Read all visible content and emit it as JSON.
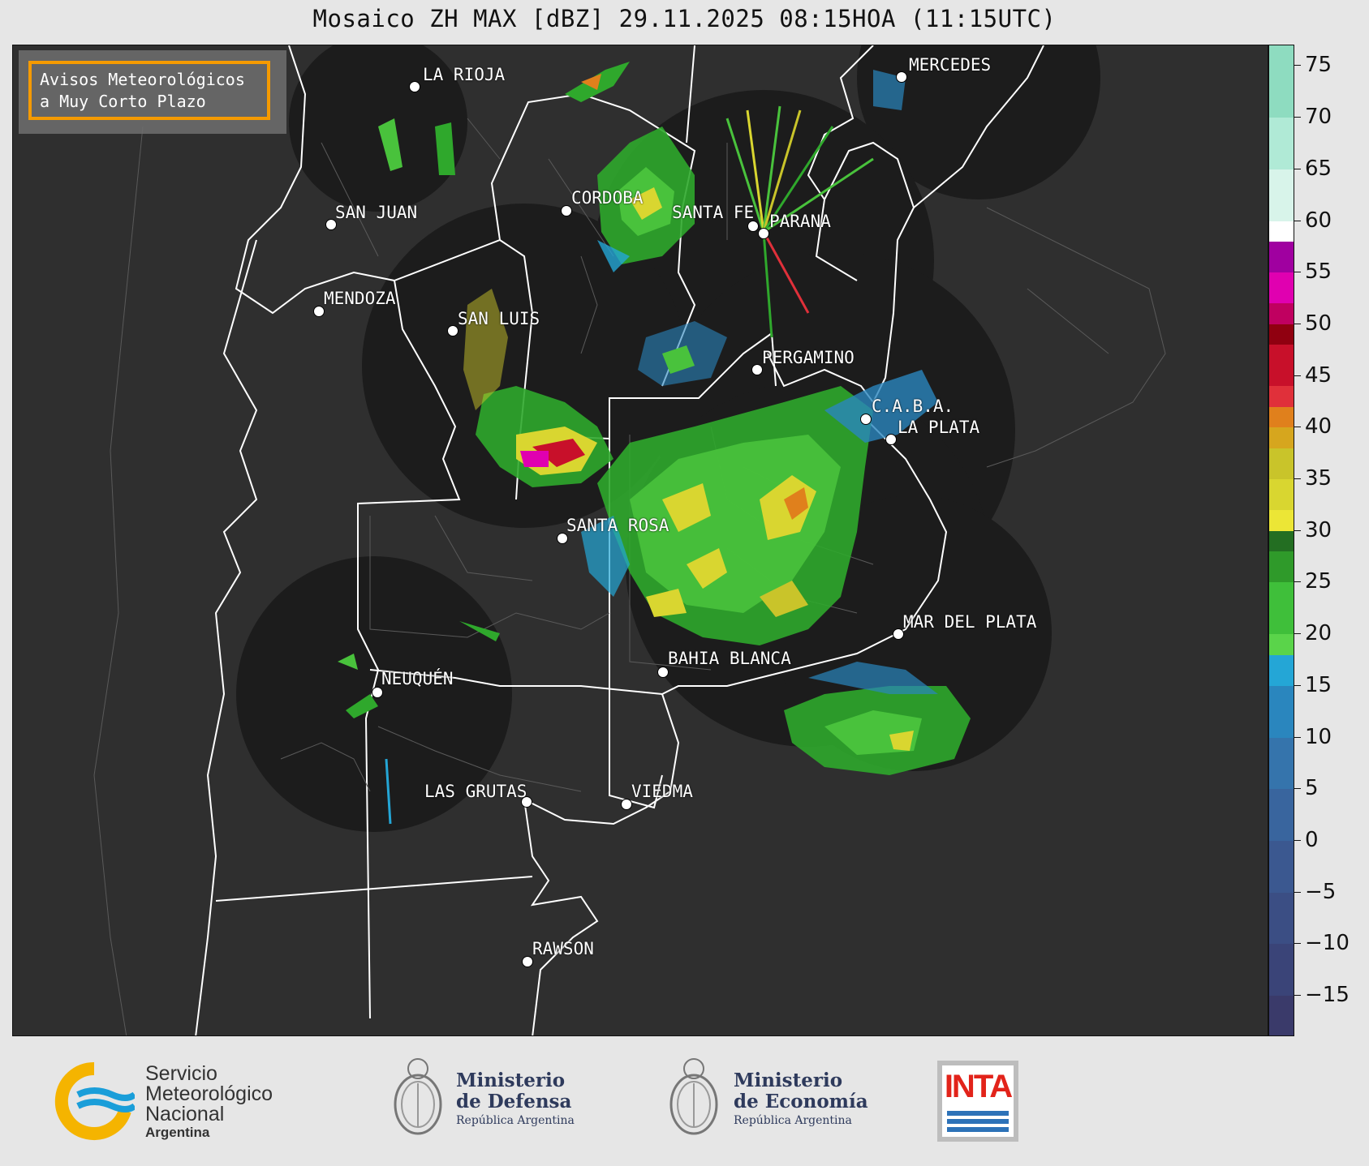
{
  "title": "Mosaico ZH MAX [dBZ] 29.11.2025 08:15HOA (11:15UTC)",
  "notice": {
    "line1": "Avisos Meteorológicos",
    "line2": "a Muy Corto Plazo",
    "border_color": "#f59a00"
  },
  "cities": [
    {
      "name": "LA RIOJA"
    },
    {
      "name": "MERCEDES"
    },
    {
      "name": "CORDOBA"
    },
    {
      "name": "SAN JUAN"
    },
    {
      "name": "SANTA FE"
    },
    {
      "name": "PARANA"
    },
    {
      "name": "MENDOZA"
    },
    {
      "name": "SAN LUIS"
    },
    {
      "name": "PERGAMINO"
    },
    {
      "name": "C.A.B.A."
    },
    {
      "name": "LA PLATA"
    },
    {
      "name": "SANTA ROSA"
    },
    {
      "name": "MAR DEL PLATA"
    },
    {
      "name": "BAHIA BLANCA"
    },
    {
      "name": "NEUQUÉN"
    },
    {
      "name": "LAS GRUTAS"
    },
    {
      "name": "VIEDMA"
    },
    {
      "name": "RAWSON"
    }
  ],
  "colorbar": {
    "unit": "dBZ",
    "min": -19,
    "max": 77,
    "tick_labels": [
      "75",
      "70",
      "65",
      "60",
      "55",
      "50",
      "45",
      "40",
      "35",
      "30",
      "25",
      "20",
      "15",
      "10",
      "5",
      "0",
      "−5",
      "−10",
      "−15"
    ],
    "tick_values": [
      75,
      70,
      65,
      60,
      55,
      50,
      45,
      40,
      35,
      30,
      25,
      20,
      15,
      10,
      5,
      0,
      -5,
      -10,
      -15
    ],
    "bands": [
      {
        "from": -19,
        "to": -15,
        "color": "#3a3a6a"
      },
      {
        "from": -15,
        "to": -10,
        "color": "#3a4478"
      },
      {
        "from": -10,
        "to": -5,
        "color": "#3b4e84"
      },
      {
        "from": -5,
        "to": 0,
        "color": "#3b5890"
      },
      {
        "from": 0,
        "to": 5,
        "color": "#39659e"
      },
      {
        "from": 5,
        "to": 10,
        "color": "#3574ac"
      },
      {
        "from": 10,
        "to": 15,
        "color": "#2a86be"
      },
      {
        "from": 15,
        "to": 18,
        "color": "#24a6d6"
      },
      {
        "from": 18,
        "to": 20,
        "color": "#5ad44a"
      },
      {
        "from": 20,
        "to": 25,
        "color": "#3fbf3a"
      },
      {
        "from": 25,
        "to": 28,
        "color": "#2f9a2a"
      },
      {
        "from": 28,
        "to": 30,
        "color": "#236e22"
      },
      {
        "from": 30,
        "to": 32,
        "color": "#ece636"
      },
      {
        "from": 32,
        "to": 35,
        "color": "#d9d630"
      },
      {
        "from": 35,
        "to": 38,
        "color": "#c9c42a"
      },
      {
        "from": 38,
        "to": 40,
        "color": "#d6a61e"
      },
      {
        "from": 40,
        "to": 42,
        "color": "#e0801c"
      },
      {
        "from": 42,
        "to": 44,
        "color": "#e0303a"
      },
      {
        "from": 44,
        "to": 48,
        "color": "#c8102a"
      },
      {
        "from": 48,
        "to": 50,
        "color": "#900010"
      },
      {
        "from": 50,
        "to": 52,
        "color": "#c00060"
      },
      {
        "from": 52,
        "to": 55,
        "color": "#e000b0"
      },
      {
        "from": 55,
        "to": 58,
        "color": "#a000a0"
      },
      {
        "from": 58,
        "to": 60,
        "color": "#ffffff"
      },
      {
        "from": 60,
        "to": 65,
        "color": "#d8f4ea"
      },
      {
        "from": 65,
        "to": 70,
        "color": "#b0ead6"
      },
      {
        "from": 70,
        "to": 77,
        "color": "#8edcc0"
      }
    ]
  },
  "logos": {
    "smn": {
      "line1": "Servicio",
      "line2": "Meteorológico",
      "line3": "Nacional",
      "line4": "Argentina"
    },
    "defensa": {
      "line1": "Ministerio",
      "line2": "de Defensa",
      "line3": "República Argentina"
    },
    "economia": {
      "line1": "Ministerio",
      "line2": "de Economía",
      "line3": "República Argentina"
    },
    "inta": {
      "text": "INTA"
    }
  }
}
